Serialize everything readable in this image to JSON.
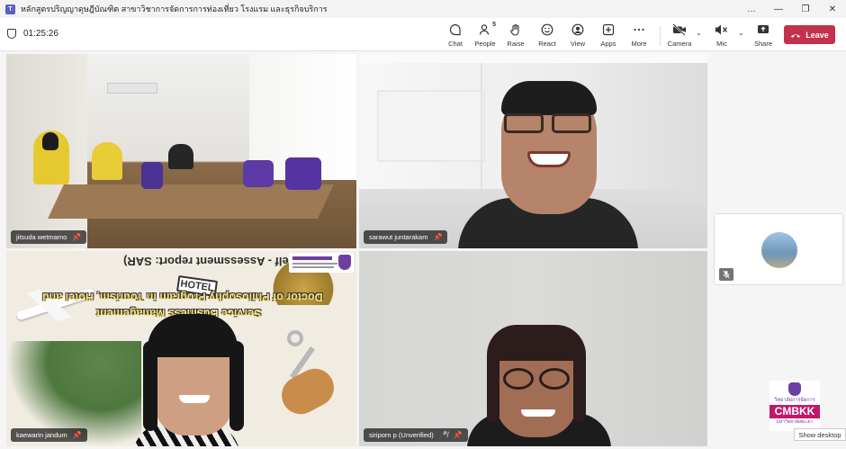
{
  "window": {
    "title": "หลักสูตรปริญญาดุษฎีบัณฑิต สาขาวิชาการจัดการการท่องเที่ยว โรงแรม และธุรกิจบริการ",
    "controls": [
      "…",
      "—",
      "❐",
      "✕"
    ]
  },
  "meeting": {
    "timer": "01:25:26"
  },
  "toolbar": {
    "chat": "Chat",
    "people": "People",
    "people_count": "5",
    "raise": "Raise",
    "react": "React",
    "view": "View",
    "apps": "Apps",
    "more": "More",
    "camera": "Camera",
    "mic": "Mic",
    "share": "Share",
    "leave": "Leave"
  },
  "participants": [
    {
      "name": "jitsuda wetmamo",
      "active": false,
      "muted": false
    },
    {
      "name": "sarawut juntarakam",
      "active": true,
      "muted": false
    },
    {
      "name": "kaewarin jandum",
      "active": false,
      "muted": false
    },
    {
      "name": "siriporn p (Unverified)",
      "active": false,
      "muted": true
    }
  ],
  "poster": {
    "line1": "(Self - Assessment report: SAR)",
    "line2": "Doctor of Philosophy Program in Tourism, Hotel and",
    "line3": "Service Business Management",
    "sign": "HOTEL"
  },
  "logo": {
    "thai_top": "วิทยาลัยการจัดการ",
    "abbr": "CMBKK",
    "thai_bottom": "มหาวิทยาลัยพะเยา"
  },
  "taskbar": {
    "show_desktop": "Show desktop"
  },
  "colors": {
    "leave": "#c4314b",
    "active_outline": "#6264a7",
    "logo_magenta": "#c2186b",
    "logo_purple": "#6c3fa3"
  }
}
